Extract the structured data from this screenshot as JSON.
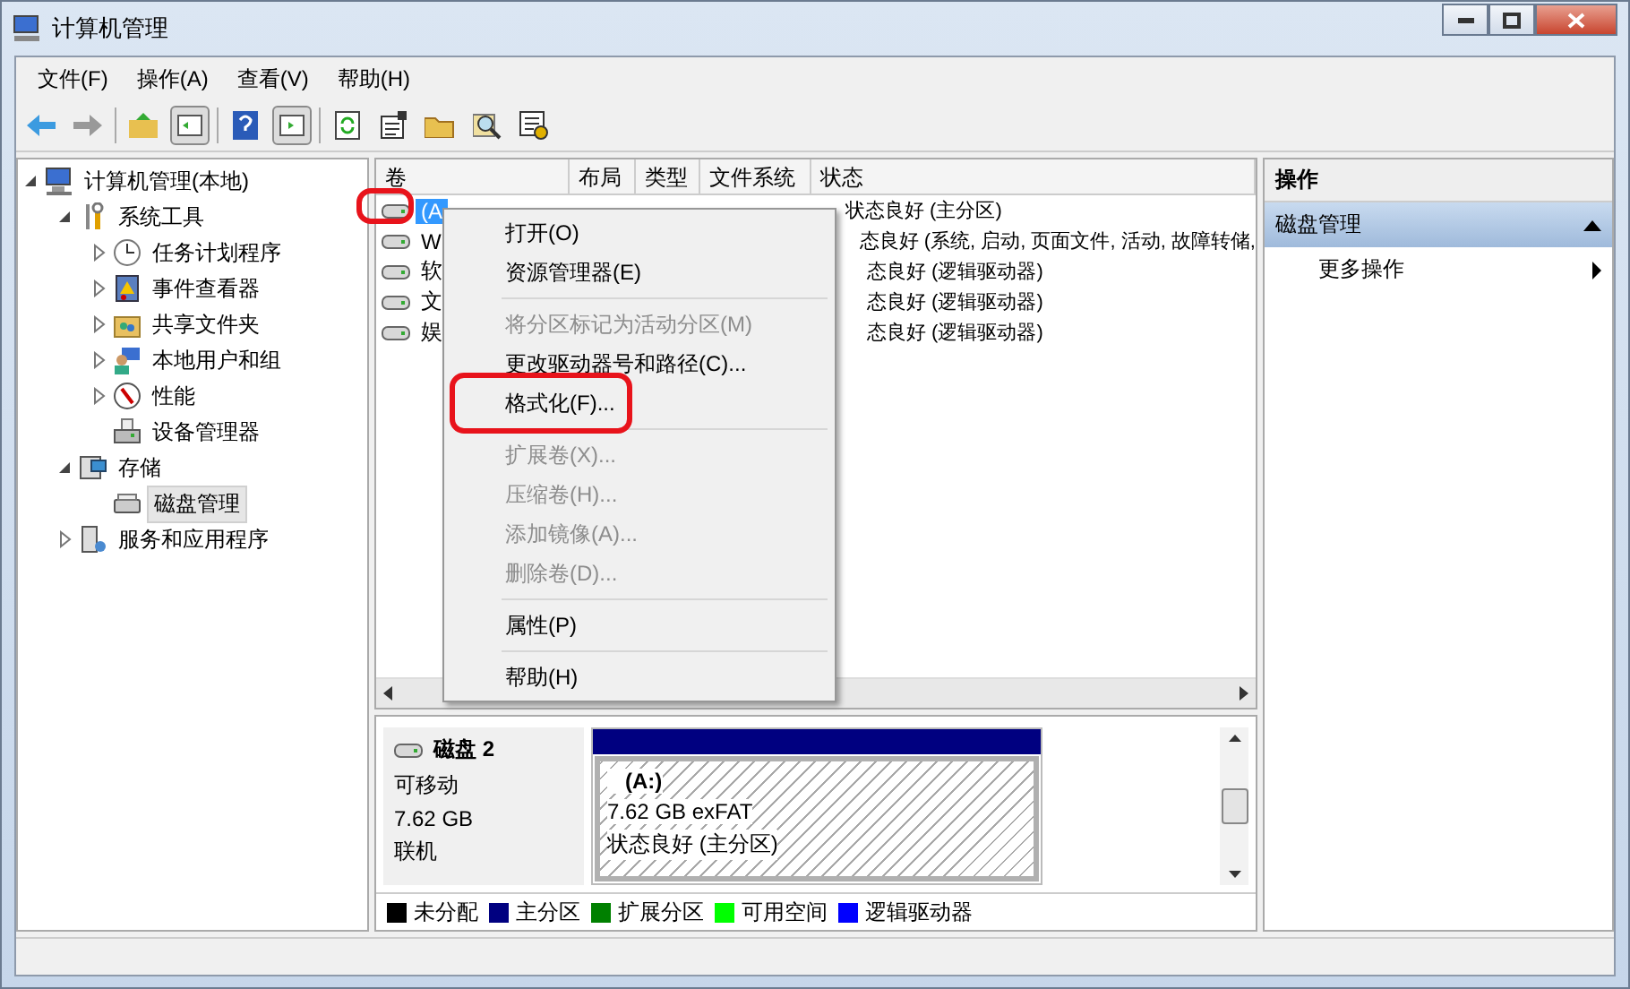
{
  "window": {
    "title": "计算机管理"
  },
  "menu_bar": [
    "文件(F)",
    "操作(A)",
    "查看(V)",
    "帮助(H)"
  ],
  "tree": [
    {
      "label": "计算机管理(本地)",
      "selected": false,
      "expanded": true,
      "children": [
        {
          "label": "系统工具",
          "selected": false,
          "expanded": true,
          "children": [
            {
              "label": "任务计划程序",
              "selected": false,
              "expanded": false
            },
            {
              "label": "事件查看器",
              "selected": false,
              "expanded": false
            },
            {
              "label": "共享文件夹",
              "selected": false,
              "expanded": false
            },
            {
              "label": "本地用户和组",
              "selected": false,
              "expanded": false
            },
            {
              "label": "性能",
              "selected": false,
              "expanded": false
            },
            {
              "label": "设备管理器",
              "selected": false
            }
          ]
        },
        {
          "label": "存储",
          "selected": false,
          "expanded": true,
          "children": [
            {
              "label": "磁盘管理",
              "selected": true
            }
          ]
        },
        {
          "label": "服务和应用程序",
          "selected": false,
          "expanded": false
        }
      ]
    }
  ],
  "table": {
    "columns": [
      "卷",
      "布局",
      "类型",
      "文件系统",
      "状态"
    ],
    "rows": [
      {
        "volume": "(A",
        "status": "状态良好 (主分区)",
        "selected": true
      },
      {
        "volume": "W",
        "status": "态良好 (系统, 启动, 页面文件, 活动, 故障转储,",
        "selected": false
      },
      {
        "volume": "软",
        "status": "态良好 (逻辑驱动器)",
        "selected": false
      },
      {
        "volume": "文",
        "status": "态良好 (逻辑驱动器)",
        "selected": false
      },
      {
        "volume": "娱",
        "status": "态良好 (逻辑驱动器)",
        "selected": false
      }
    ]
  },
  "context_menu": {
    "items": [
      {
        "kind": "item",
        "label": "打开(O)",
        "disabled": false
      },
      {
        "kind": "item",
        "label": "资源管理器(E)",
        "disabled": false
      },
      {
        "kind": "separator"
      },
      {
        "kind": "item",
        "label": "将分区标记为活动分区(M)",
        "disabled": true
      },
      {
        "kind": "item",
        "label": "更改驱动器号和路径(C)...",
        "disabled": false
      },
      {
        "kind": "item",
        "label": "格式化(F)...",
        "disabled": false
      },
      {
        "kind": "separator"
      },
      {
        "kind": "item",
        "label": "扩展卷(X)...",
        "disabled": true
      },
      {
        "kind": "item",
        "label": "压缩卷(H)...",
        "disabled": true
      },
      {
        "kind": "item",
        "label": "添加镜像(A)...",
        "disabled": true
      },
      {
        "kind": "item",
        "label": "删除卷(D)...",
        "disabled": true
      },
      {
        "kind": "separator"
      },
      {
        "kind": "item",
        "label": "属性(P)",
        "disabled": false
      },
      {
        "kind": "separator"
      },
      {
        "kind": "item",
        "label": "帮助(H)",
        "disabled": false
      }
    ]
  },
  "disk": {
    "name": "磁盘 2",
    "type": "可移动",
    "size": "7.62 GB",
    "state": "联机",
    "partition": {
      "label": "(A:)",
      "size_fs": "7.62 GB exFAT",
      "status": "状态良好 (主分区)"
    }
  },
  "legend": [
    {
      "label": "未分配",
      "color": "#000000"
    },
    {
      "label": "主分区",
      "color": "#000080"
    },
    {
      "label": "扩展分区",
      "color": "#008000"
    },
    {
      "label": "可用空间",
      "color": "#00ff00"
    },
    {
      "label": "逻辑驱动器",
      "color": "#0000ff"
    }
  ],
  "actions_pane": {
    "title": "操作",
    "section": "磁盘管理",
    "items": [
      "更多操作"
    ]
  }
}
